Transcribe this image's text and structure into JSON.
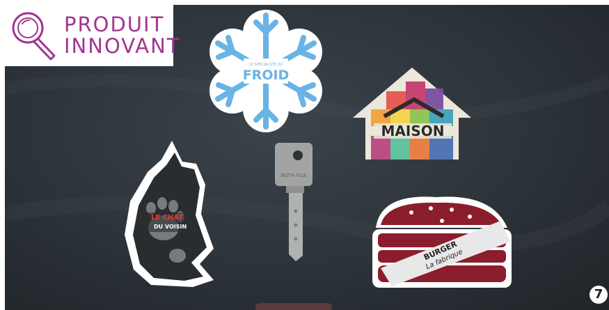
{
  "badge": {
    "line1": "PRODUIT",
    "line2": "INNOVANT",
    "color": "#a1358f"
  },
  "page_number": "7",
  "items": {
    "snowflake": {
      "small_text": "LE SPÉCIALISTE DU",
      "brand": "FROID",
      "color": "#6ab3e5"
    },
    "house": {
      "brand": "MAISON"
    },
    "cat": {
      "line1": "LE CHAT",
      "line2": "DU VOISIN"
    },
    "key": {
      "engraving": "BOTH FILE"
    },
    "burger": {
      "line1": "BURGER",
      "line2": "La fabrique",
      "color": "#8c1d2c"
    }
  },
  "icons": {
    "badge_icon": "magnifier-icon"
  }
}
